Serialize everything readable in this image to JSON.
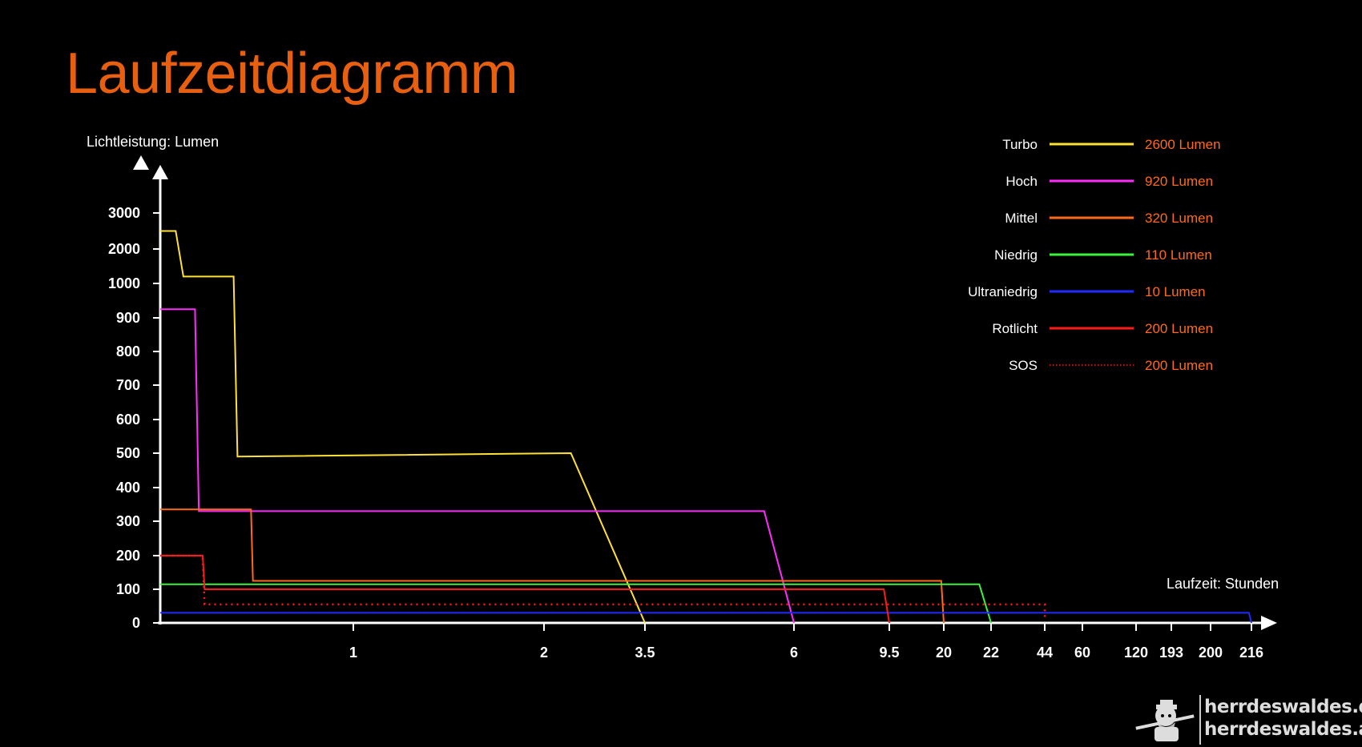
{
  "title": "Laufzeitdiagramm",
  "brand": {
    "line1": "herrdeswaldes.de",
    "line2": "herrdeswaldes.at"
  },
  "chart_data": {
    "type": "line",
    "title": "Laufzeitdiagramm",
    "ylabel": "Lichtleistung: Lumen",
    "xlabel": "Laufzeit: Stunden",
    "y_ticks": [
      "0",
      "100",
      "200",
      "300",
      "400",
      "500",
      "600",
      "700",
      "800",
      "900",
      "1000",
      "2000",
      "3000"
    ],
    "x_ticks": [
      "1",
      "2",
      "3.5",
      "6",
      "9.5",
      "20",
      "22",
      "44",
      "60",
      "120",
      "193",
      "200",
      "216"
    ],
    "y_scale": "nonlinear (ticks evenly spaced)",
    "x_scale": "nonlinear (ticks unevenly spaced)",
    "grid": false,
    "legend_position": "top-right",
    "series": [
      {
        "name": "Turbo",
        "label": "2600 Lumen",
        "color": "#ffe135",
        "style": "solid",
        "points": [
          [
            0,
            2500
          ],
          [
            0.08,
            2500
          ],
          [
            0.12,
            1200
          ],
          [
            0.38,
            1200
          ],
          [
            0.4,
            490
          ],
          [
            2.4,
            500
          ],
          [
            3.5,
            0
          ]
        ]
      },
      {
        "name": "Hoch",
        "label": "920 Lumen",
        "color": "#ff2bff",
        "style": "solid",
        "points": [
          [
            0,
            925
          ],
          [
            0.18,
            925
          ],
          [
            0.2,
            330
          ],
          [
            5.5,
            330
          ],
          [
            6,
            0
          ]
        ]
      },
      {
        "name": "Mittel",
        "label": "320 Lumen",
        "color": "#ff6a1a",
        "style": "solid",
        "points": [
          [
            0,
            335
          ],
          [
            0.47,
            335
          ],
          [
            0.48,
            125
          ],
          [
            19.5,
            125
          ],
          [
            20,
            0
          ]
        ]
      },
      {
        "name": "Niedrig",
        "label": "110 Lumen",
        "color": "#3df23d",
        "style": "solid",
        "points": [
          [
            0,
            115
          ],
          [
            21.5,
            115
          ],
          [
            22,
            0
          ]
        ]
      },
      {
        "name": "Ultraniedrig",
        "label": "10 Lumen",
        "color": "#1f2bff",
        "style": "solid",
        "points": [
          [
            0,
            30
          ],
          [
            215,
            30
          ],
          [
            216,
            0
          ]
        ]
      },
      {
        "name": "Rotlicht",
        "label": "200 Lumen",
        "color": "#ff1a1a",
        "style": "solid",
        "points": [
          [
            0,
            200
          ],
          [
            0.22,
            200
          ],
          [
            0.23,
            100
          ],
          [
            9.3,
            100
          ],
          [
            9.5,
            0
          ]
        ]
      },
      {
        "name": "SOS",
        "label": "200 Lumen",
        "color": "#ff1a1a",
        "style": "dotted",
        "points": [
          [
            0,
            200
          ],
          [
            0.22,
            200
          ],
          [
            0.23,
            55
          ],
          [
            44,
            55
          ],
          [
            44,
            10
          ]
        ]
      }
    ]
  }
}
